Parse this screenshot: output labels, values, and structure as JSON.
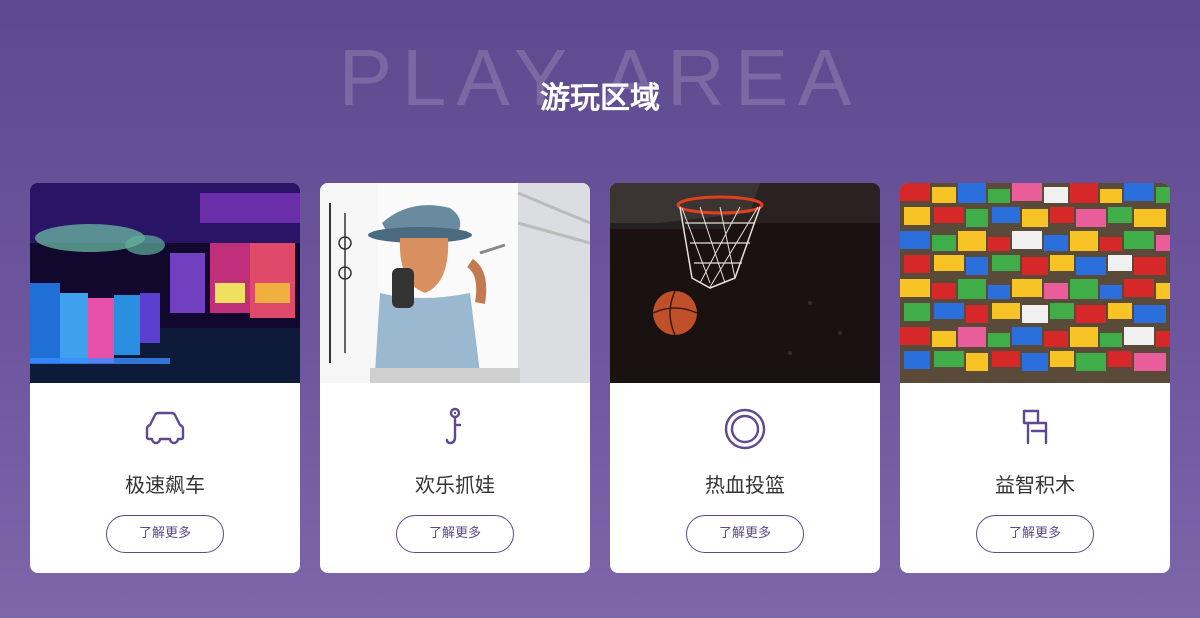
{
  "section": {
    "bg_title": "PLAY AREA",
    "title": "游玩区域"
  },
  "colors": {
    "background": "#5d4a8e",
    "accent": "#5d4a8e",
    "card": "#ffffff",
    "text": "#333333"
  },
  "cards": [
    {
      "title": "极速飙车",
      "icon": "car-icon",
      "photo": "arcade-game-hall-photo",
      "button": "了解更多"
    },
    {
      "title": "欢乐抓娃",
      "icon": "claw-hook-icon",
      "photo": "graffiti-man-phone-photo",
      "button": "了解更多"
    },
    {
      "title": "热血投篮",
      "icon": "basketball-hoop-icon",
      "photo": "basketball-net-photo",
      "button": "了解更多"
    },
    {
      "title": "益智积木",
      "icon": "building-block-icon",
      "photo": "lego-bricks-photo",
      "button": "了解更多"
    }
  ]
}
